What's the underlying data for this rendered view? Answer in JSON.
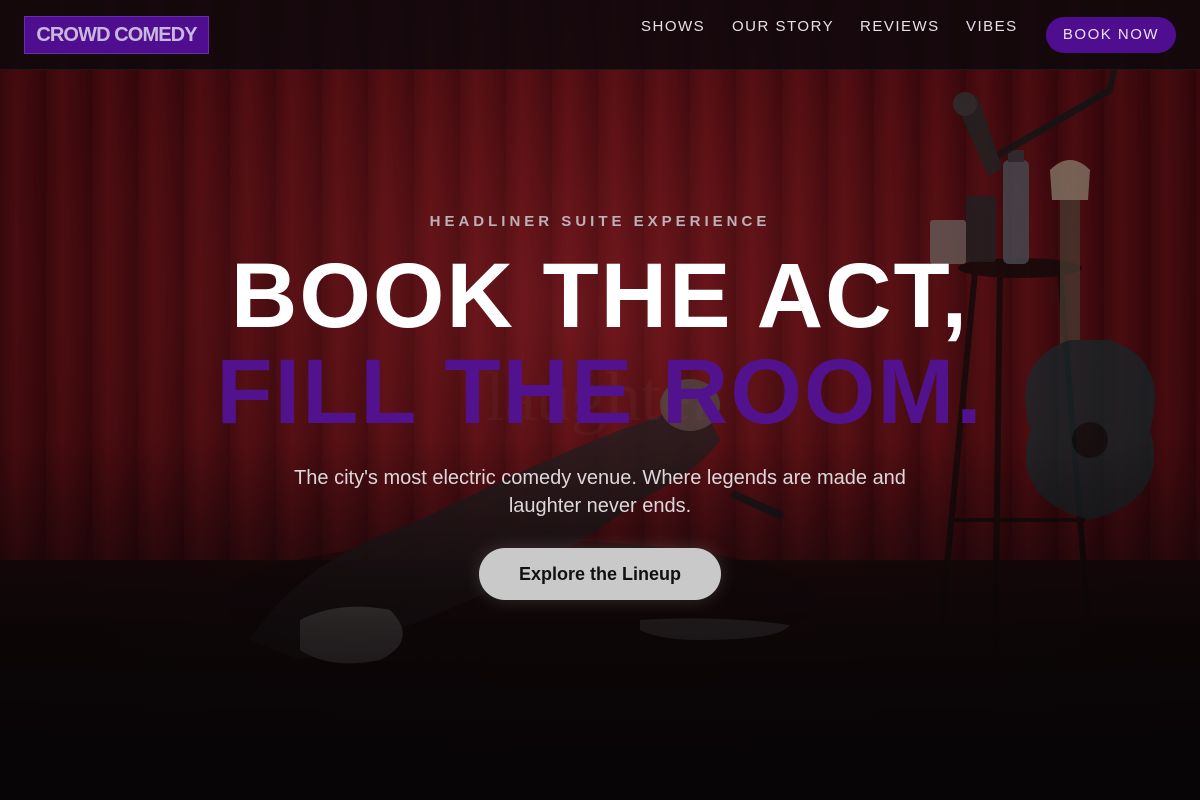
{
  "header": {
    "logo": "CROWD COMEDY",
    "nav": [
      {
        "label": "SHOWS"
      },
      {
        "label": "OUR STORY"
      },
      {
        "label": "REVIEWS"
      },
      {
        "label": "VIBES"
      }
    ],
    "cta_label": "BOOK NOW"
  },
  "hero": {
    "eyebrow": "HEADLINER SUITE EXPERIENCE",
    "headline_line1": "BOOK THE ACT,",
    "headline_line2": "FILL THE ROOM.",
    "subtitle": "The city's most electric comedy venue. Where legends are made and laughter never ends.",
    "cta_label": "Explore the Lineup"
  },
  "colors": {
    "brand_purple": "#4f0e8f",
    "headline_purple": "#52128e",
    "curtain_red": "#6e1418",
    "nav_background": "#12090c",
    "cta_button": "#c9c9c9"
  },
  "icons": {
    "background": "comedy-stage-photo",
    "props": [
      "microphone-stand-icon",
      "guitar-icon",
      "bar-stool-icon",
      "water-bottle-icon"
    ]
  }
}
